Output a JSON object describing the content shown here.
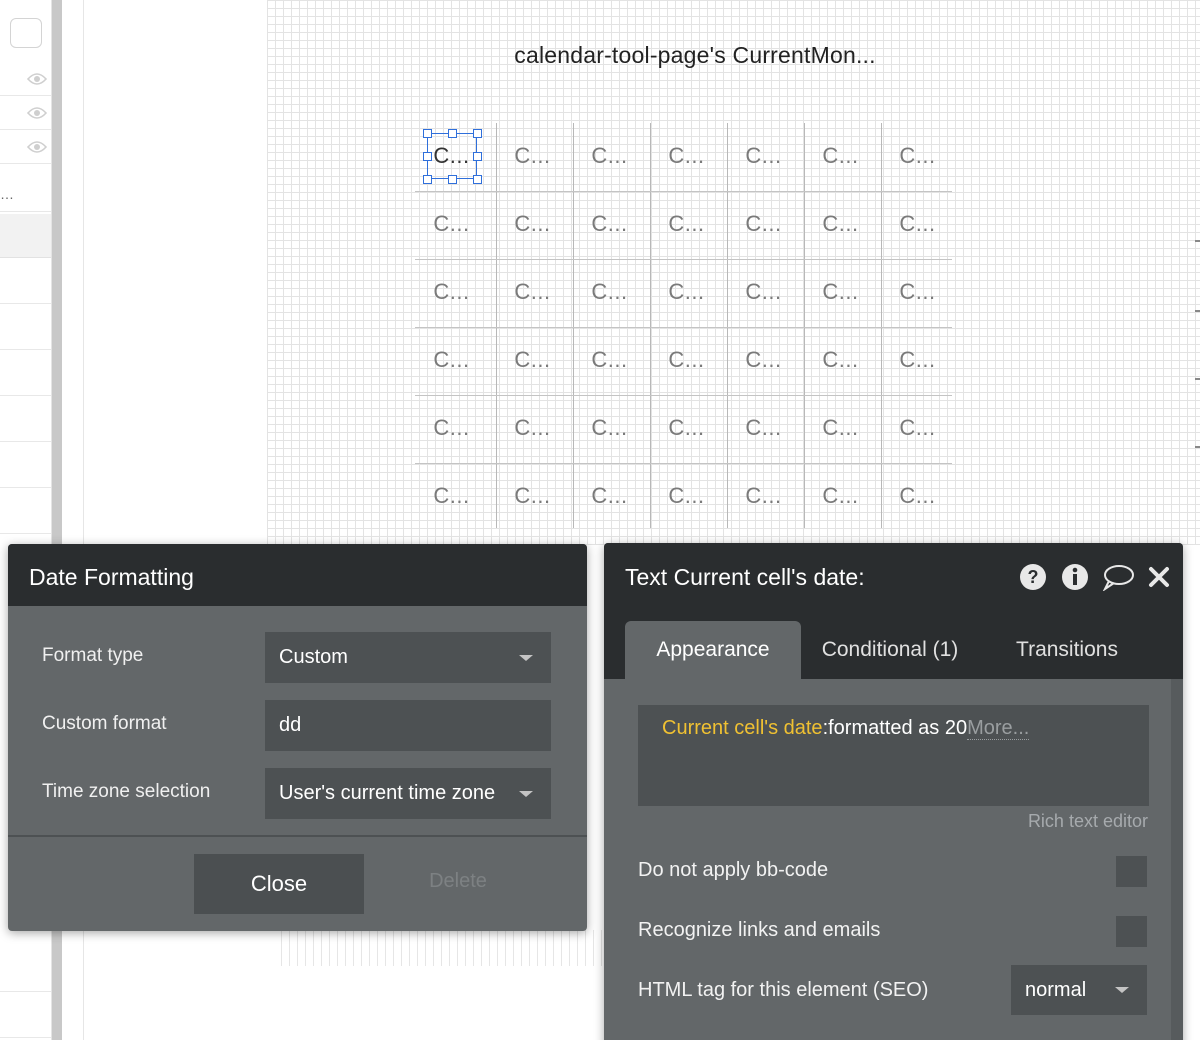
{
  "repeating_group": {
    "title": "calendar-tool-page's CurrentMon...",
    "cell_label": "C...",
    "columns": 7,
    "rows": 6
  },
  "date_formatting": {
    "title": "Date Formatting",
    "fields": [
      {
        "label": "Format type",
        "value": "Custom",
        "type": "dropdown"
      },
      {
        "label": "Custom format",
        "value": "dd",
        "type": "input"
      },
      {
        "label": "Time zone selection",
        "value": "User's current time zone",
        "type": "dropdown"
      }
    ],
    "close_label": "Close",
    "delete_label": "Delete"
  },
  "text_editor": {
    "title": "Text Current cell's date:",
    "icons": [
      "help-icon",
      "info-icon",
      "comment-icon",
      "close-icon"
    ],
    "tabs": [
      {
        "label": "Appearance",
        "active": true
      },
      {
        "label": "Conditional (1)",
        "active": false
      },
      {
        "label": "Transitions",
        "active": false
      }
    ],
    "content": {
      "dynamic": "Current cell's date",
      "static": ":formatted as 20",
      "more": "More..."
    },
    "rich_text_editor_label": "Rich text editor",
    "options": [
      {
        "label": "Do not apply bb-code",
        "checked": false
      },
      {
        "label": "Recognize links and emails",
        "checked": false
      }
    ],
    "html_tag": {
      "label": "HTML tag for this element (SEO)",
      "value": "normal"
    }
  },
  "colors": {
    "popup_bg": "#636769",
    "header_bg": "#2a2d2f",
    "field_bg": "#4d5153",
    "dynamic_expression": "#f0c132",
    "selection": "#2f6fdb"
  }
}
